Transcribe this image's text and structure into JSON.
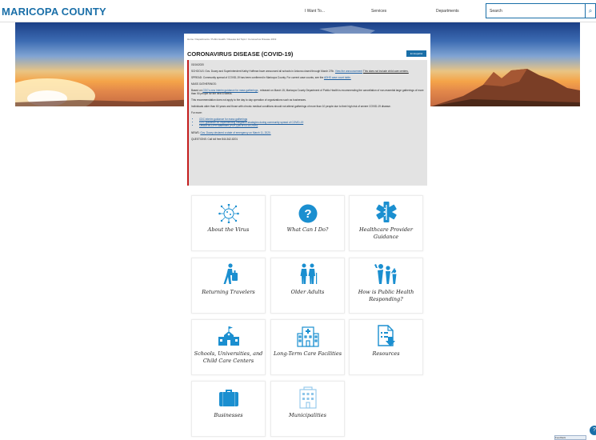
{
  "header": {
    "brand": "MARICOPA COUNTY",
    "nav": [
      "I Want To...",
      "Services",
      "Departments"
    ],
    "search_placeholder": "Search"
  },
  "breadcrumb": "Home / Departments / Public Health / Disease Ed Topic / Coronavirus Disease 2019",
  "page_title": "CORONAVIRUS DISEASE (COVID-19)",
  "espanol_label": "En Español",
  "alert": {
    "date": "03/16/2020",
    "schools_a": "SCHOOLS: Gov. Ducey and Superintendent Kathy Hoffman have announced all schools in Arizona closed through March 27th.",
    "schools_link": "View the announcement",
    "schools_b": "This does not include child care centers.",
    "spread_a": "SPREAD: Community spread of COVID-19 has been confirmed in Maricopa County. For current case counts, see the",
    "spread_link": "ADHS case count table.",
    "gatherings_head": "MASS GATHERINGS:",
    "gatherings_a": "Based on",
    "gatherings_link": "CDC's new interim guidance for mass gatherings",
    "gatherings_b": ", released on March 15, Maricopa County Department of Public Health is recommending the cancellation of non-essential large gatherings of more than 50 people for the next 8 weeks.",
    "recommendation": "This recommendation does not apply to the day to day operation of organizations such as businesses.",
    "older": "Individuals older than 60 years and those with chronic medical conditions should not attend gatherings of more than 10 people due to their high risk of severe COVID-19 disease.",
    "for_more": "For more:",
    "links": [
      "CDC interim guidance for mass gatherings",
      "CDC guidance for implementing mitigation strategies during community spread of COVID-19",
      "Official MCDPH statement (PDF) (as of 03.15.2020)"
    ],
    "news_a": "NEWS:",
    "news_link": "Gov. Ducey declared a state of emergency on March 11, 2020.",
    "questions": "QUESTIONS: Call toll free 844-542-8201"
  },
  "tiles": [
    {
      "label": "About the Virus",
      "icon": "virus-icon"
    },
    {
      "label": "What Can I Do?",
      "icon": "question-circle-icon"
    },
    {
      "label": "Healthcare Provider Guidance",
      "icon": "star-of-life-icon"
    },
    {
      "label": "Returning Travelers",
      "icon": "traveler-luggage-icon"
    },
    {
      "label": "Older Adults",
      "icon": "older-couple-icon"
    },
    {
      "label": "How is Public Health Responding?",
      "icon": "family-group-icon"
    },
    {
      "label": "Schools, Universities, and Child Care Centers",
      "icon": "school-building-icon"
    },
    {
      "label": "Long-Term Care Facilities",
      "icon": "care-facility-icon"
    },
    {
      "label": "Resources",
      "icon": "document-download-icon"
    },
    {
      "label": "Businesses",
      "icon": "briefcase-icon"
    },
    {
      "label": "Municipalities",
      "icon": "city-building-icon"
    }
  ],
  "colors": {
    "brand": "#1a6fa8",
    "icon": "#1b8fd0",
    "alert_border": "#c41e1e",
    "alert_bg": "#e3e3e3"
  },
  "feedback_label": "Feedback"
}
